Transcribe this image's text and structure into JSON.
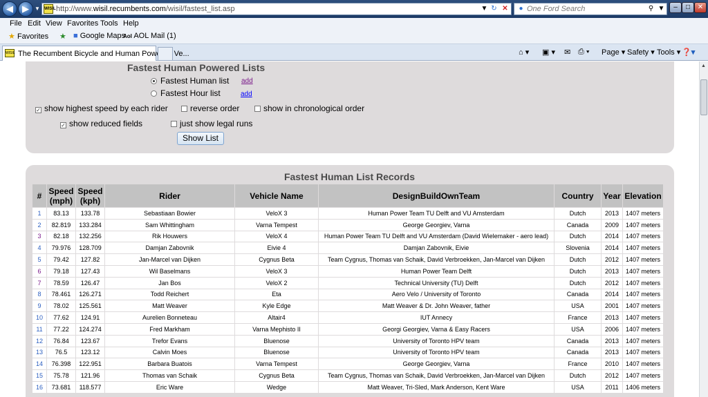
{
  "browser": {
    "url_prefix": "http://www.",
    "url_domain": "wisil.recumbents.com",
    "url_path": "/wisil/fastest_list.asp",
    "search_placeholder": "One Ford Search",
    "site_icon_label": "WISIL",
    "menu": [
      "File",
      "Edit",
      "View",
      "Favorites",
      "Tools",
      "Help"
    ],
    "favorites_label": "Favorites",
    "fav_links": [
      "Google Maps",
      "AOL Mail (1)"
    ],
    "tab_title": "The Recumbent Bicycle and Human Powered Ve...",
    "commands": [
      "Page",
      "Safety",
      "Tools"
    ]
  },
  "form": {
    "heading": "Fastest Human Powered Lists",
    "radio_fastest_human": "Fastest Human list",
    "radio_fastest_hour": "Fastest Hour list",
    "add_label": "add",
    "opt_highest_speed": "show highest speed by each rider",
    "opt_reverse": "reverse order",
    "opt_chronological": "show in chronological order",
    "opt_reduced": "show reduced fields",
    "opt_legal": "just show legal runs",
    "show_button": "Show List"
  },
  "records": {
    "heading": "Fastest Human List Records",
    "columns": [
      "#",
      "Speed (mph)",
      "Speed (kph)",
      "Rider",
      "Vehicle Name",
      "DesignBuildOwnTeam",
      "Country",
      "Year",
      "Elevation"
    ],
    "rows": [
      [
        "1",
        "83.13",
        "133.78",
        "Sebastiaan Bowier",
        "VeloX 3",
        "Human Power Team TU Delft and VU Amsterdam",
        "Dutch",
        "2013",
        "1407 meters"
      ],
      [
        "2",
        "82.819",
        "133.284",
        "Sam Whittingham",
        "Varna Tempest",
        "George Georgiev, Varna",
        "Canada",
        "2009",
        "1407 meters"
      ],
      [
        "3",
        "82.18",
        "132.256",
        "Rik Houwers",
        "VeloX 4",
        "Human Power Team TU Delft and VU Amsterdam (David Wielemaker - aero lead)",
        "Dutch",
        "2014",
        "1407 meters"
      ],
      [
        "4",
        "79.976",
        "128.709",
        "Damjan Zabovnik",
        "Eivie 4",
        "Damjan Zabovnik, Eivie",
        "Slovenia",
        "2014",
        "1407 meters"
      ],
      [
        "5",
        "79.42",
        "127.82",
        "Jan-Marcel van Dijken",
        "Cygnus Beta",
        "Team Cygnus, Thomas van Schaik, David Verbroekken, Jan-Marcel van Dijken",
        "Dutch",
        "2012",
        "1407 meters"
      ],
      [
        "6",
        "79.18",
        "127.43",
        "Wil Baselmans",
        "VeloX 3",
        "Human Power Team Delft",
        "Dutch",
        "2013",
        "1407 meters"
      ],
      [
        "7",
        "78.59",
        "126.47",
        "Jan Bos",
        "VeloX 2",
        "Technical University (TU) Delft",
        "Dutch",
        "2012",
        "1407 meters"
      ],
      [
        "8",
        "78.461",
        "126.271",
        "Todd Reichert",
        "Eta",
        "Aero Velo / University of Toronto",
        "Canada",
        "2014",
        "1407 meters"
      ],
      [
        "9",
        "78.02",
        "125.561",
        "Matt Weaver",
        "Kyle Edge",
        "Matt Weaver & Dr. John Weaver, father",
        "USA",
        "2001",
        "1407 meters"
      ],
      [
        "10",
        "77.62",
        "124.91",
        "Aurelien Bonneteau",
        "Altair4",
        "IUT Annecy",
        "France",
        "2013",
        "1407 meters"
      ],
      [
        "11",
        "77.22",
        "124.274",
        "Fred Markham",
        "Varna Mephisto II",
        "Georgi Georgiev, Varna & Easy Racers",
        "USA",
        "2006",
        "1407 meters"
      ],
      [
        "12",
        "76.84",
        "123.67",
        "Trefor Evans",
        "Bluenose",
        "University of Toronto HPV team",
        "Canada",
        "2013",
        "1407 meters"
      ],
      [
        "13",
        "76.5",
        "123.12",
        "Calvin Moes",
        "Bluenose",
        "University of Toronto HPV team",
        "Canada",
        "2013",
        "1407 meters"
      ],
      [
        "14",
        "76.398",
        "122.951",
        "Barbara Buatois",
        "Varna Tempest",
        "George Georgiev, Varna",
        "France",
        "2010",
        "1407 meters"
      ],
      [
        "15",
        "75.78",
        "121.96",
        "Thomas van Schaik",
        "Cygnus Beta",
        "Team Cygnus, Thomas van Schaik, David Verbroekken, Jan-Marcel van Dijken",
        "Dutch",
        "2012",
        "1407 meters"
      ],
      [
        "16",
        "73.681",
        "118.577",
        "Eric Ware",
        "Wedge",
        "Matt Weaver, Tri-Sled, Mark Anderson, Kent Ware",
        "USA",
        "2011",
        "1406 meters"
      ]
    ]
  }
}
